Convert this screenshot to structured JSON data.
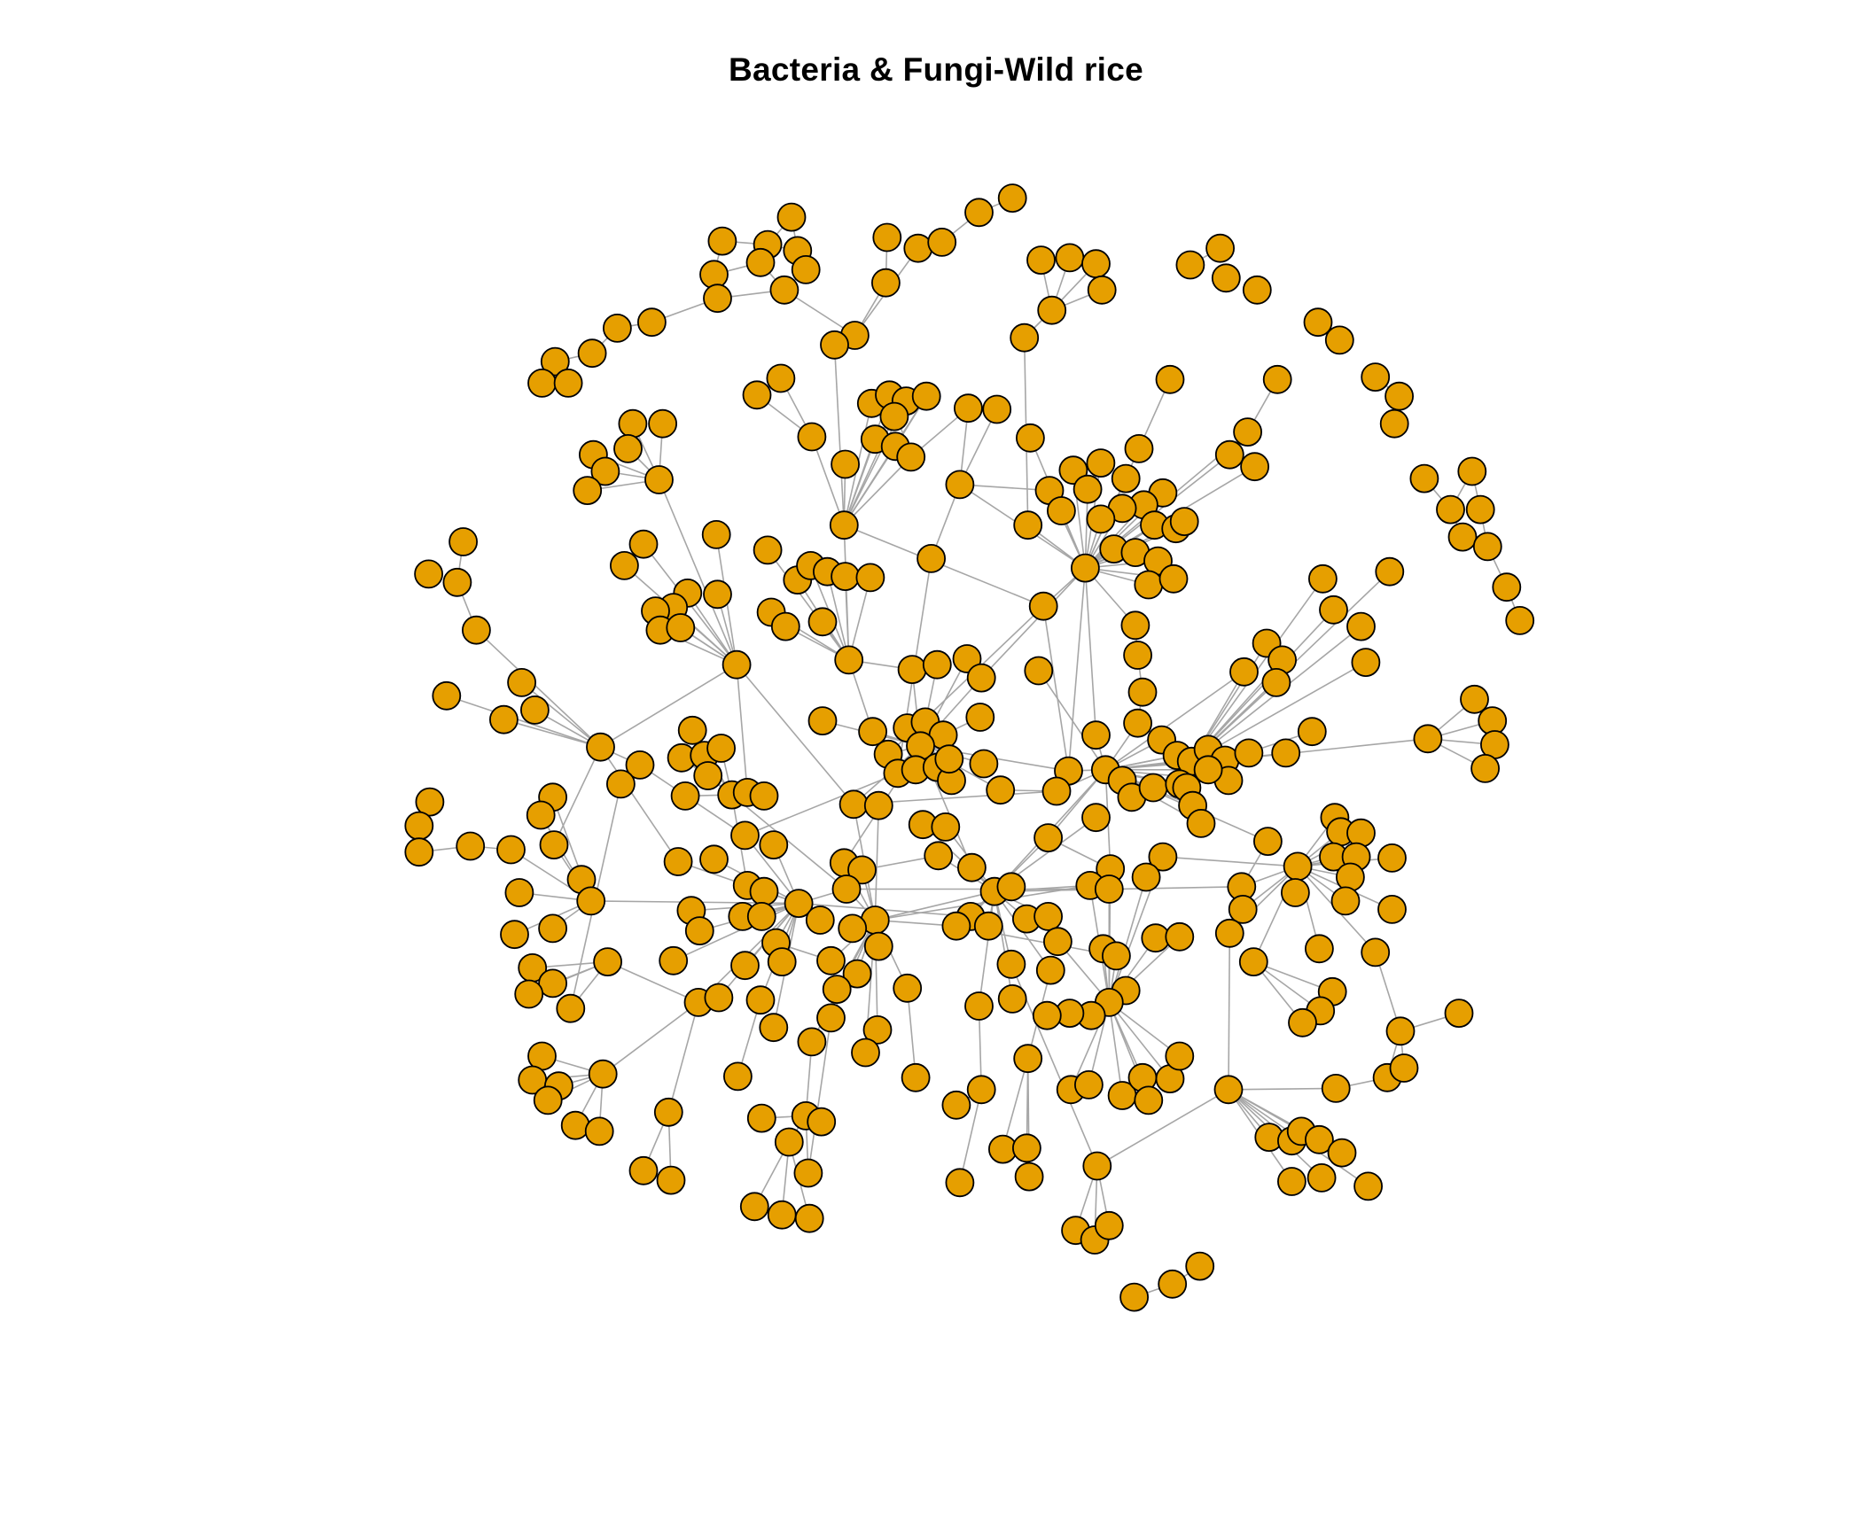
{
  "figure": {
    "title": "Bacteria & Fungi-Wild rice"
  },
  "style": {
    "node_fill": "#E69F00",
    "node_stroke": "#000000",
    "edge_color": "#A6A6A6"
  }
}
